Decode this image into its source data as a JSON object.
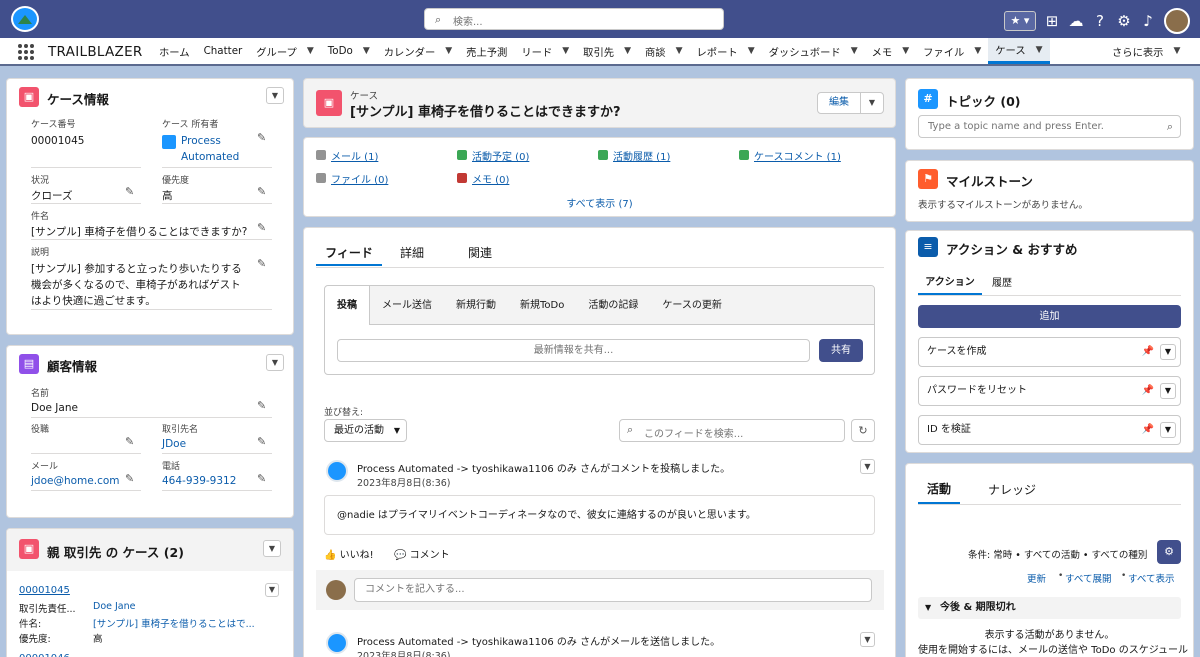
{
  "topbar": {
    "search_placeholder": "検索..."
  },
  "nav": {
    "app_name": "TRAILBLAZER",
    "items": [
      {
        "label": "ホーム",
        "chev": false
      },
      {
        "label": "Chatter",
        "chev": false
      },
      {
        "label": "グループ",
        "chev": true
      },
      {
        "label": "ToDo",
        "chev": true
      },
      {
        "label": "カレンダー",
        "chev": true
      },
      {
        "label": "売上予測",
        "chev": false
      },
      {
        "label": "リード",
        "chev": true
      },
      {
        "label": "取引先",
        "chev": true
      },
      {
        "label": "商談",
        "chev": true
      },
      {
        "label": "レポート",
        "chev": true
      },
      {
        "label": "ダッシュボード",
        "chev": true
      },
      {
        "label": "メモ",
        "chev": true
      },
      {
        "label": "ファイル",
        "chev": true
      },
      {
        "label": "ケース",
        "chev": true,
        "active": true
      }
    ],
    "more": "さらに表示"
  },
  "case_info": {
    "title": "ケース情報",
    "number_label": "ケース番号",
    "number": "00001045",
    "owner_label": "ケース 所有者",
    "owner_line1": "Process",
    "owner_line2": "Automated",
    "status_label": "状況",
    "status": "クローズ",
    "priority_label": "優先度",
    "priority": "高",
    "subject_label": "件名",
    "subject": "[サンプル] 車椅子を借りることはできますか?",
    "desc_label": "説明",
    "desc_lines": [
      "[サンプル] 参加すると立ったり歩いたりする",
      "機会が多くなるので、車椅子があればゲスト",
      "はより快適に過ごせます。"
    ]
  },
  "customer": {
    "title": "顧客情報",
    "name_label": "名前",
    "name": "Doe Jane",
    "role_label": "役職",
    "role": "",
    "contact_label": "取引先名",
    "contact": "JDoe",
    "email_label": "メール",
    "email": "jdoe@home.com",
    "phone_label": "電話",
    "phone": "464-939-9312"
  },
  "parent_cases": {
    "title": "親 取引先 の ケース (2)",
    "number": "00001045",
    "owner_label": "取引先責任...",
    "owner": "Doe Jane",
    "subject_label": "件名:",
    "subject": "[サンプル] 車椅子を借りることはで...",
    "priority_label": "優先度:",
    "priority": "高",
    "next_number": "00001046"
  },
  "record": {
    "object": "ケース",
    "title": "[サンプル] 車椅子を借りることはできますか?",
    "edit": "編集"
  },
  "related_links": {
    "items": [
      {
        "label": "メール (1)",
        "color": "#939393"
      },
      {
        "label": "活動予定 (0)",
        "color": "#3ba755"
      },
      {
        "label": "活動履歴 (1)",
        "color": "#3ba755"
      },
      {
        "label": "ケースコメント (1)",
        "color": "#3ba755"
      },
      {
        "label": "ファイル (0)",
        "color": "#939393"
      },
      {
        "label": "メモ (0)",
        "color": "#c23934"
      }
    ],
    "show_all": "すべて表示 (7)"
  },
  "feed": {
    "tabs": [
      "フィード",
      "詳細",
      "関連"
    ],
    "publisher_tabs": [
      "投稿",
      "メール送信",
      "新規行動",
      "新規ToDo",
      "活動の記録",
      "ケースの更新"
    ],
    "share_placeholder": "最新情報を共有...",
    "share_btn": "共有",
    "sort_label": "並び替え:",
    "sort_value": "最近の活動",
    "search_placeholder": "このフィードを検索...",
    "posts": [
      {
        "head": "Process Automated -> tyoshikawa1106 のみ さんがコメントを投稿しました。",
        "time": "2023年8月8日(8:36)",
        "body": "@nadie はプライマリイベントコーディネータなので、彼女に連絡するのが良いと思います。"
      },
      {
        "head": "Process Automated -> tyoshikawa1106 のみ さんがメールを送信しました。",
        "time": "2023年8月8日(8:36)"
      }
    ],
    "like": "いいね!",
    "comment": "コメント",
    "comment_placeholder": "コメントを記入する..."
  },
  "topics": {
    "title": "トピック (0)",
    "placeholder": "Type a topic name and press Enter."
  },
  "milestones": {
    "title": "マイルストーン",
    "empty": "表示するマイルストーンがありません。"
  },
  "actions": {
    "title": "アクション & おすすめ",
    "tabs": [
      "アクション",
      "履歴"
    ],
    "add": "追加",
    "items": [
      "ケースを作成",
      "パスワードをリセット",
      "ID を検証"
    ]
  },
  "activity": {
    "tabs": [
      "活動",
      "ナレッジ"
    ],
    "filter": "条件: 常時 • すべての活動 • すべての種別",
    "links": [
      "更新",
      "すべて展開",
      "すべて表示"
    ],
    "section": "今後 & 期限切れ",
    "empty": "表示する活動がありません。",
    "hint": "使用を開始するには、メールの送信や ToDo のスケジュール"
  }
}
